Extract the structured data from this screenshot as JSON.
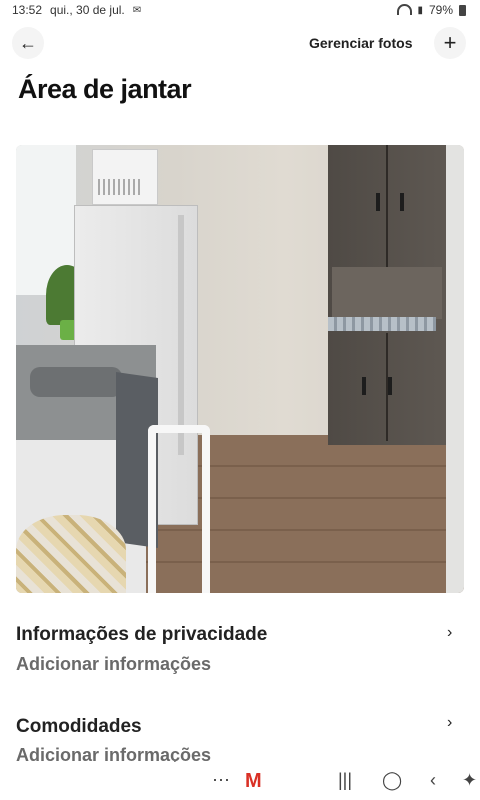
{
  "status": {
    "time": "13:52",
    "date": "qui., 30 de jul.",
    "battery": "79%",
    "icons": [
      "gmail-notification-icon",
      "wifi-icon",
      "signal-icon",
      "battery-icon"
    ]
  },
  "header": {
    "manage_photos": "Gerenciar fotos",
    "back_icon": "arrow-left-icon",
    "add_icon": "plus-icon"
  },
  "page": {
    "title": "Área de jantar"
  },
  "sections": [
    {
      "title": "Informações de privacidade",
      "subtitle": "Adicionar informações"
    },
    {
      "title": "Comodidades",
      "subtitle": "Adicionar informações"
    }
  ],
  "nav": {
    "icons": [
      "apps-grid-icon",
      "gmail-icon",
      "recents-icon",
      "home-icon",
      "back-icon",
      "accessibility-icon"
    ]
  }
}
